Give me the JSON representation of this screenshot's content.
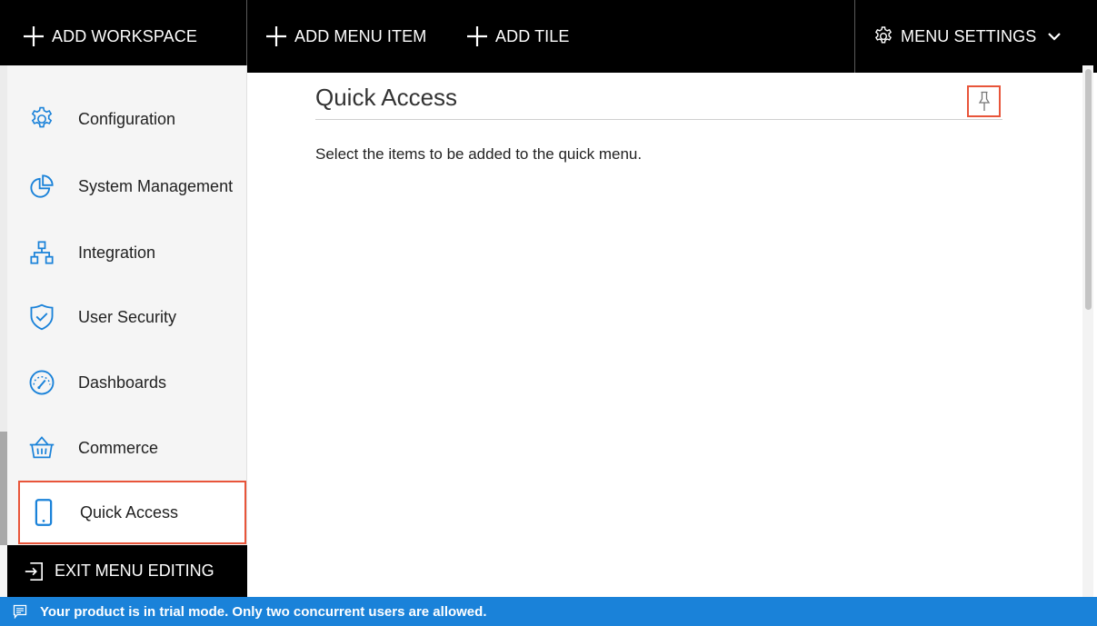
{
  "toolbar": {
    "add_workspace": "ADD WORKSPACE",
    "add_menu_item": "ADD MENU ITEM",
    "add_tile": "ADD TILE",
    "menu_settings": "MENU SETTINGS"
  },
  "sidebar": {
    "items": [
      {
        "label": "Configuration",
        "icon": "gear-icon"
      },
      {
        "label": "System Management",
        "icon": "pie-chart-icon"
      },
      {
        "label": "Integration",
        "icon": "hierarchy-icon"
      },
      {
        "label": "User Security",
        "icon": "shield-check-icon"
      },
      {
        "label": "Dashboards",
        "icon": "gauge-icon"
      },
      {
        "label": "Commerce",
        "icon": "basket-icon"
      },
      {
        "label": "Quick Access",
        "icon": "mobile-phone-icon",
        "active": true
      }
    ],
    "exit_label": "EXIT MENU EDITING"
  },
  "main": {
    "title": "Quick Access",
    "description": "Select the items to be added to the quick menu."
  },
  "banner": {
    "text": "Your product is in trial mode. Only two concurrent users are allowed."
  },
  "colors": {
    "accent_highlight": "#e8553a",
    "banner_blue": "#1a82d9",
    "icon_blue": "#1a82d9",
    "toolbar_bg": "#000000"
  }
}
